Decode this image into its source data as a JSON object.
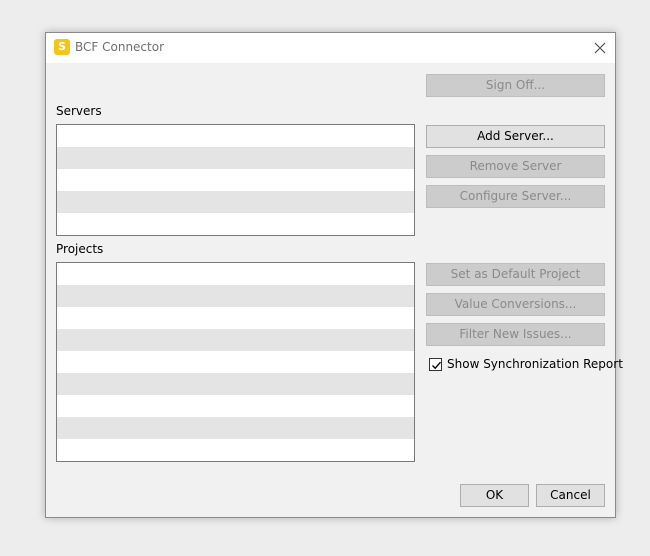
{
  "window": {
    "title": "BCF Connector",
    "app_icon_glyph": "S",
    "accent_color": "#f5c518"
  },
  "servers": {
    "label": "Servers",
    "rows": [
      "",
      "",
      "",
      "",
      ""
    ]
  },
  "projects": {
    "label": "Projects",
    "rows": [
      "",
      "",
      "",
      "",
      "",
      "",
      "",
      "",
      ""
    ]
  },
  "buttons": {
    "sign_off": "Sign Off...",
    "add_server": "Add Server...",
    "remove_server": "Remove Server",
    "configure_server": "Configure Server...",
    "set_default_project": "Set as Default Project",
    "value_conversions": "Value Conversions...",
    "filter_new_issues": "Filter New Issues...",
    "ok": "OK",
    "cancel": "Cancel"
  },
  "options": {
    "show_sync_report_label": "Show Synchronization Report",
    "show_sync_report_checked": true
  }
}
